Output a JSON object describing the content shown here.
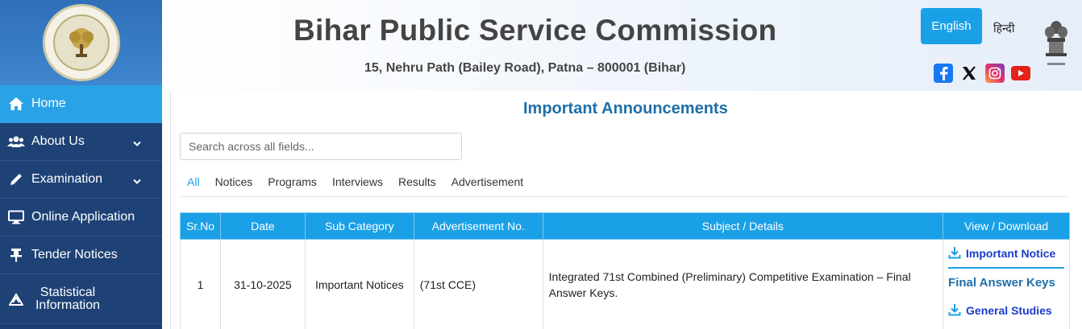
{
  "header": {
    "title": "Bihar Public Service Commission",
    "address": "15, Nehru Path (Bailey Road), Patna – 800001 (Bihar)",
    "lang_english": "English",
    "lang_hindi": "हिन्दी"
  },
  "sidebar": {
    "items": [
      {
        "label": "Home",
        "icon": "home-icon"
      },
      {
        "label": "About Us",
        "icon": "users-icon"
      },
      {
        "label": "Examination",
        "icon": "pencil-icon"
      },
      {
        "label": "Online Application",
        "icon": "monitor-icon"
      },
      {
        "label": "Tender Notices",
        "icon": "pin-icon"
      },
      {
        "label": "Statistical Information",
        "icon": "chart-icon"
      }
    ]
  },
  "main": {
    "title": "Important Announcements",
    "search_placeholder": "Search across all fields...",
    "tabs": [
      "All",
      "Notices",
      "Programs",
      "Interviews",
      "Results",
      "Advertisement"
    ],
    "table": {
      "headers": [
        "Sr.No",
        "Date",
        "Sub Category",
        "Advertisement No.",
        "Subject / Details",
        "View / Download"
      ],
      "rows": [
        {
          "sr": "1",
          "date": "31-10-2025",
          "sub_category": "Important Notices",
          "adv_no": "(71st CCE)",
          "subject": "Integrated 71st Combined (Preliminary) Competitive Examination – Final Answer Keys.",
          "links": {
            "important_notice": "Important Notice",
            "heading": "Final Answer Keys",
            "general_studies": "General Studies"
          }
        }
      ]
    }
  },
  "colors": {
    "accent": "#1aa0e6",
    "sidebar": "#1e4276",
    "title": "#1f6fa8"
  }
}
